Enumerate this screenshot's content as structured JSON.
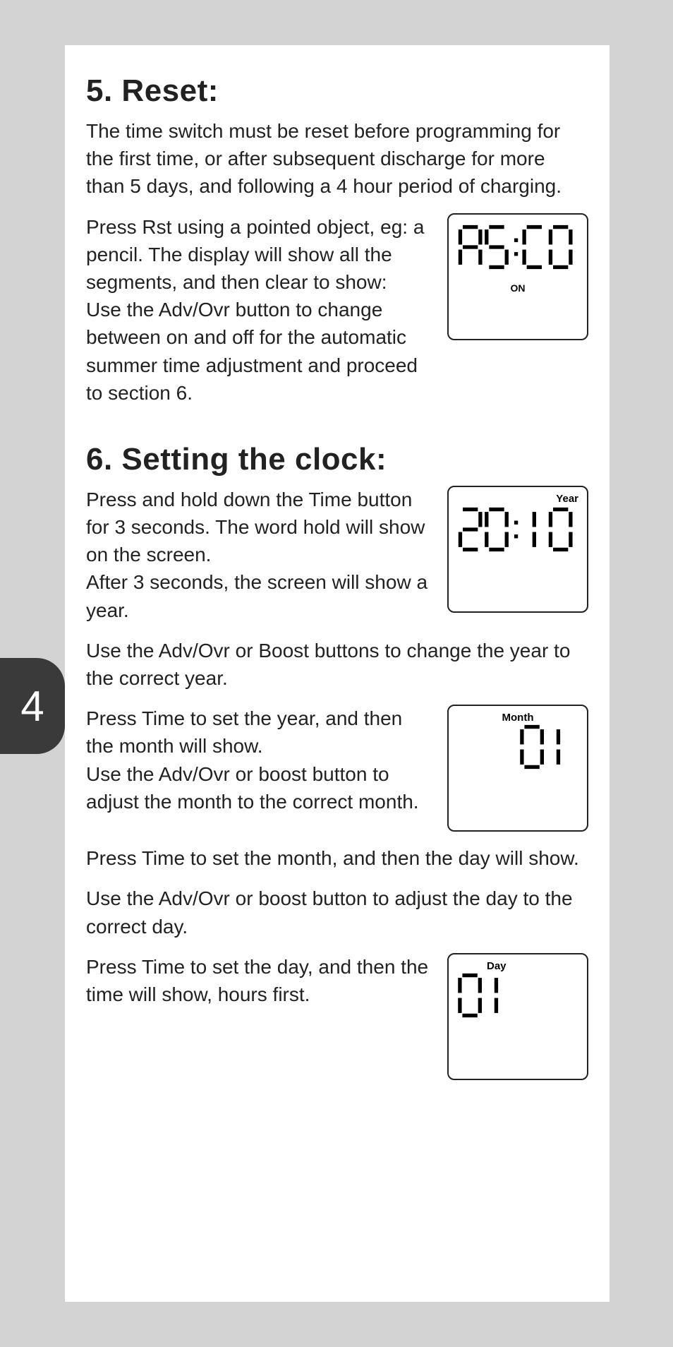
{
  "pageNumber": "4",
  "section5": {
    "heading": "5. Reset:",
    "p1": "The time switch must be reset before programming for the first time, or after subsequent discharge for more than 5 days, and following a 4 hour period of charging.",
    "p2": "Press Rst using a pointed object, eg: a pencil. The display will show all the segments, and then clear to show:",
    "p3": "Use the Adv/Ovr button to change between on and off for the automatic summer time adjustment and proceed to section 6.",
    "lcd1_on": "ON"
  },
  "section6": {
    "heading": "6. Setting the clock:",
    "p1": "Press and hold down the Time button for 3 seconds. The word hold will show on the screen.",
    "p2": "After 3 seconds, the screen will show a year.",
    "p3": "Use the Adv/Ovr or Boost buttons to change the year to the correct year.",
    "p4": "Press Time to set the year, and then the month will show.",
    "p5": "Use the Adv/Ovr or boost button to adjust the month to the correct month.",
    "p6": "Press Time to set the month, and then the day will show.",
    "p7": "Use the Adv/Ovr or boost button to adjust the day to the correct day.",
    "p8": "Press Time to set the day, and then the time will show, hours first.",
    "lcd2_label": "Year",
    "lcd3_label": "Month",
    "lcd4_label": "Day"
  }
}
